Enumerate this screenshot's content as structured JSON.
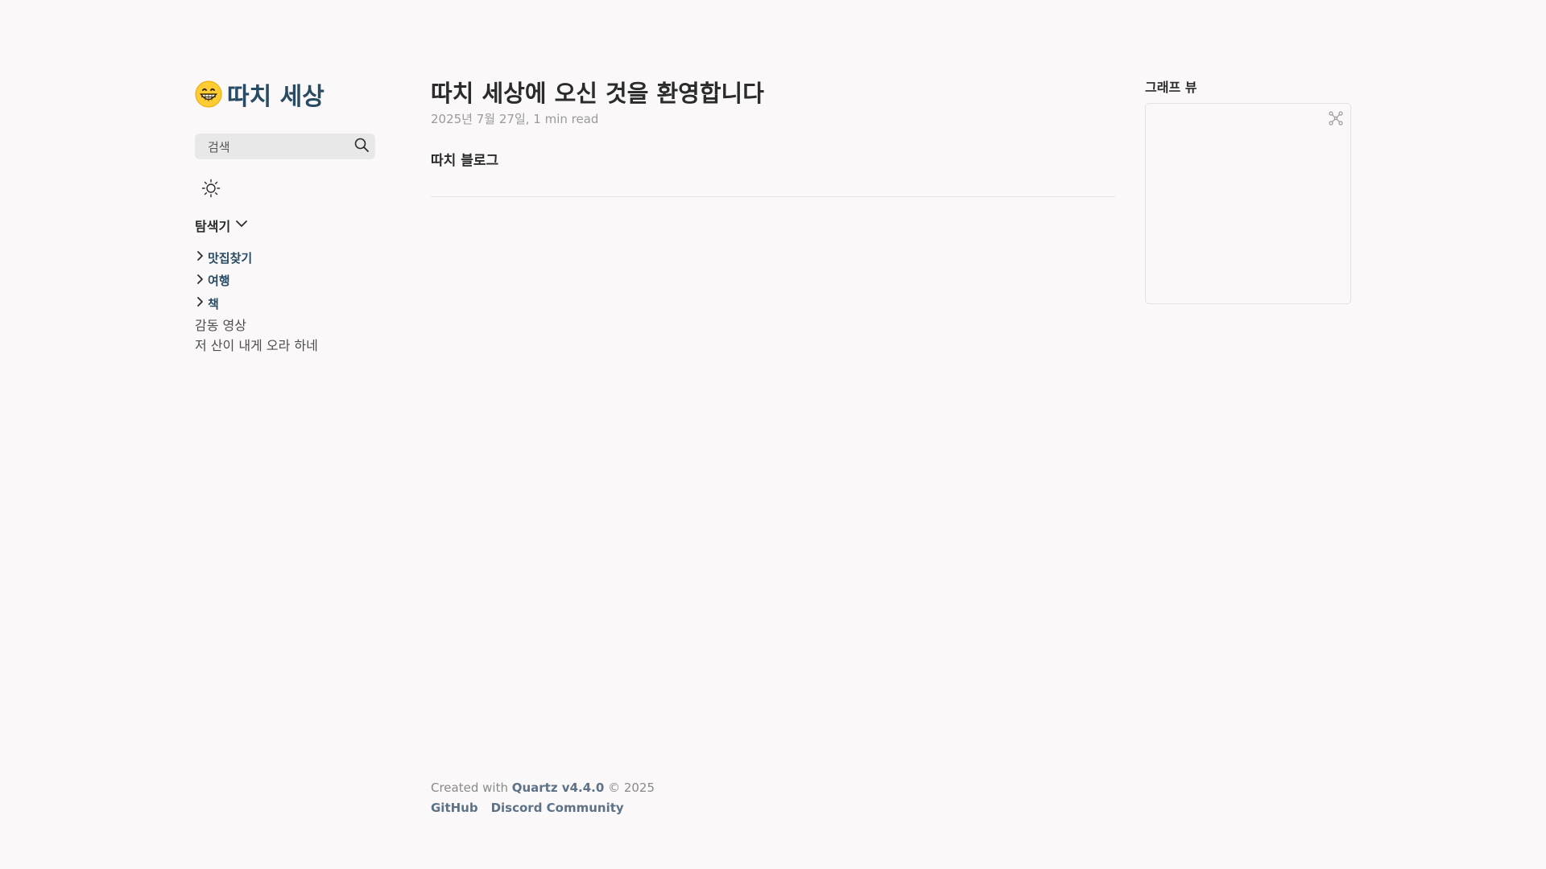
{
  "sidebar": {
    "site_title": "따치 세상",
    "site_emoji": "grinning-face",
    "search_placeholder": "검색",
    "explorer_title": "탐색기",
    "folders": [
      "맛집찾기",
      "여행",
      "책"
    ],
    "files": [
      "감동 영상",
      "저 산이 내게 오라 하네"
    ]
  },
  "article": {
    "title": "따치 세상에 오신 것을 환영합니다",
    "meta": "2025년 7월 27일, 1 min read",
    "body": "따치 블로그"
  },
  "footer": {
    "prefix": "Created with ",
    "quartz_link": "Quartz v4.4.0",
    "suffix": " © 2025",
    "links": [
      "GitHub",
      "Discord Community"
    ]
  },
  "graph": {
    "title": "그래프 뷰"
  },
  "colors": {
    "background": "#faf8f8",
    "accent": "#284b63",
    "text": "#2b2b2b",
    "muted": "#9a9a9a"
  }
}
